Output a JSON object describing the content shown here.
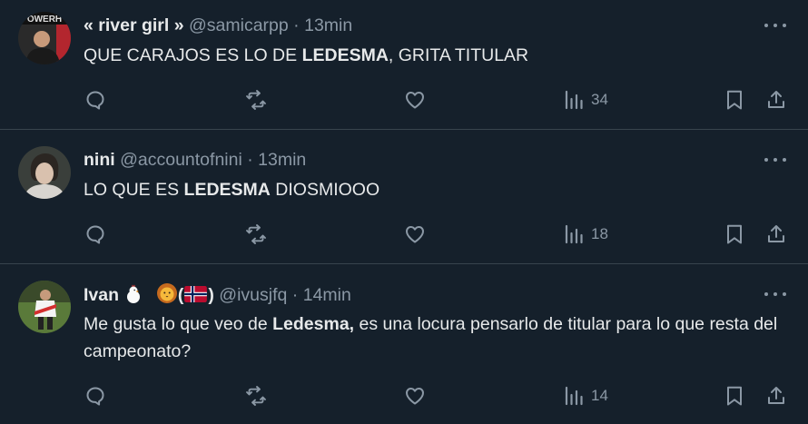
{
  "tweets": [
    {
      "name": "« river girl »",
      "handle": "@samicarpp",
      "sep": "·",
      "time": "13min",
      "text_pre": "QUE CARAJOS ES LO DE ",
      "text_bold": "LEDESMA",
      "text_post": ", GRITA TITULAR",
      "avatar_text": "OWERH",
      "views": "34"
    },
    {
      "name": "nini",
      "handle": "@accountofnini",
      "sep": "·",
      "time": "13min",
      "text_pre": "LO QUE ES ",
      "text_bold": "LEDESMA",
      "text_post": " DIOSMIOOO",
      "views": "18"
    },
    {
      "name": "Ivan",
      "name_suffix_open": "(",
      "name_suffix_close": ")",
      "handle": "@ivusjfq",
      "sep": "·",
      "time": "14min",
      "text_pre": "Me gusta lo que veo de ",
      "text_bold": "Ledesma,",
      "text_post": " es una locura pensarlo de titular para lo que resta del campeonato?",
      "views": "14"
    }
  ],
  "icons": {
    "reply": "reply-icon",
    "retweet": "retweet-icon",
    "like": "like-icon",
    "views": "views-icon",
    "bookmark": "bookmark-icon",
    "share": "share-icon",
    "more": "more-icon"
  },
  "colors": {
    "background": "#15202b",
    "text": "#e7e9ea",
    "muted": "#8b98a5",
    "divider": "#38444d"
  }
}
